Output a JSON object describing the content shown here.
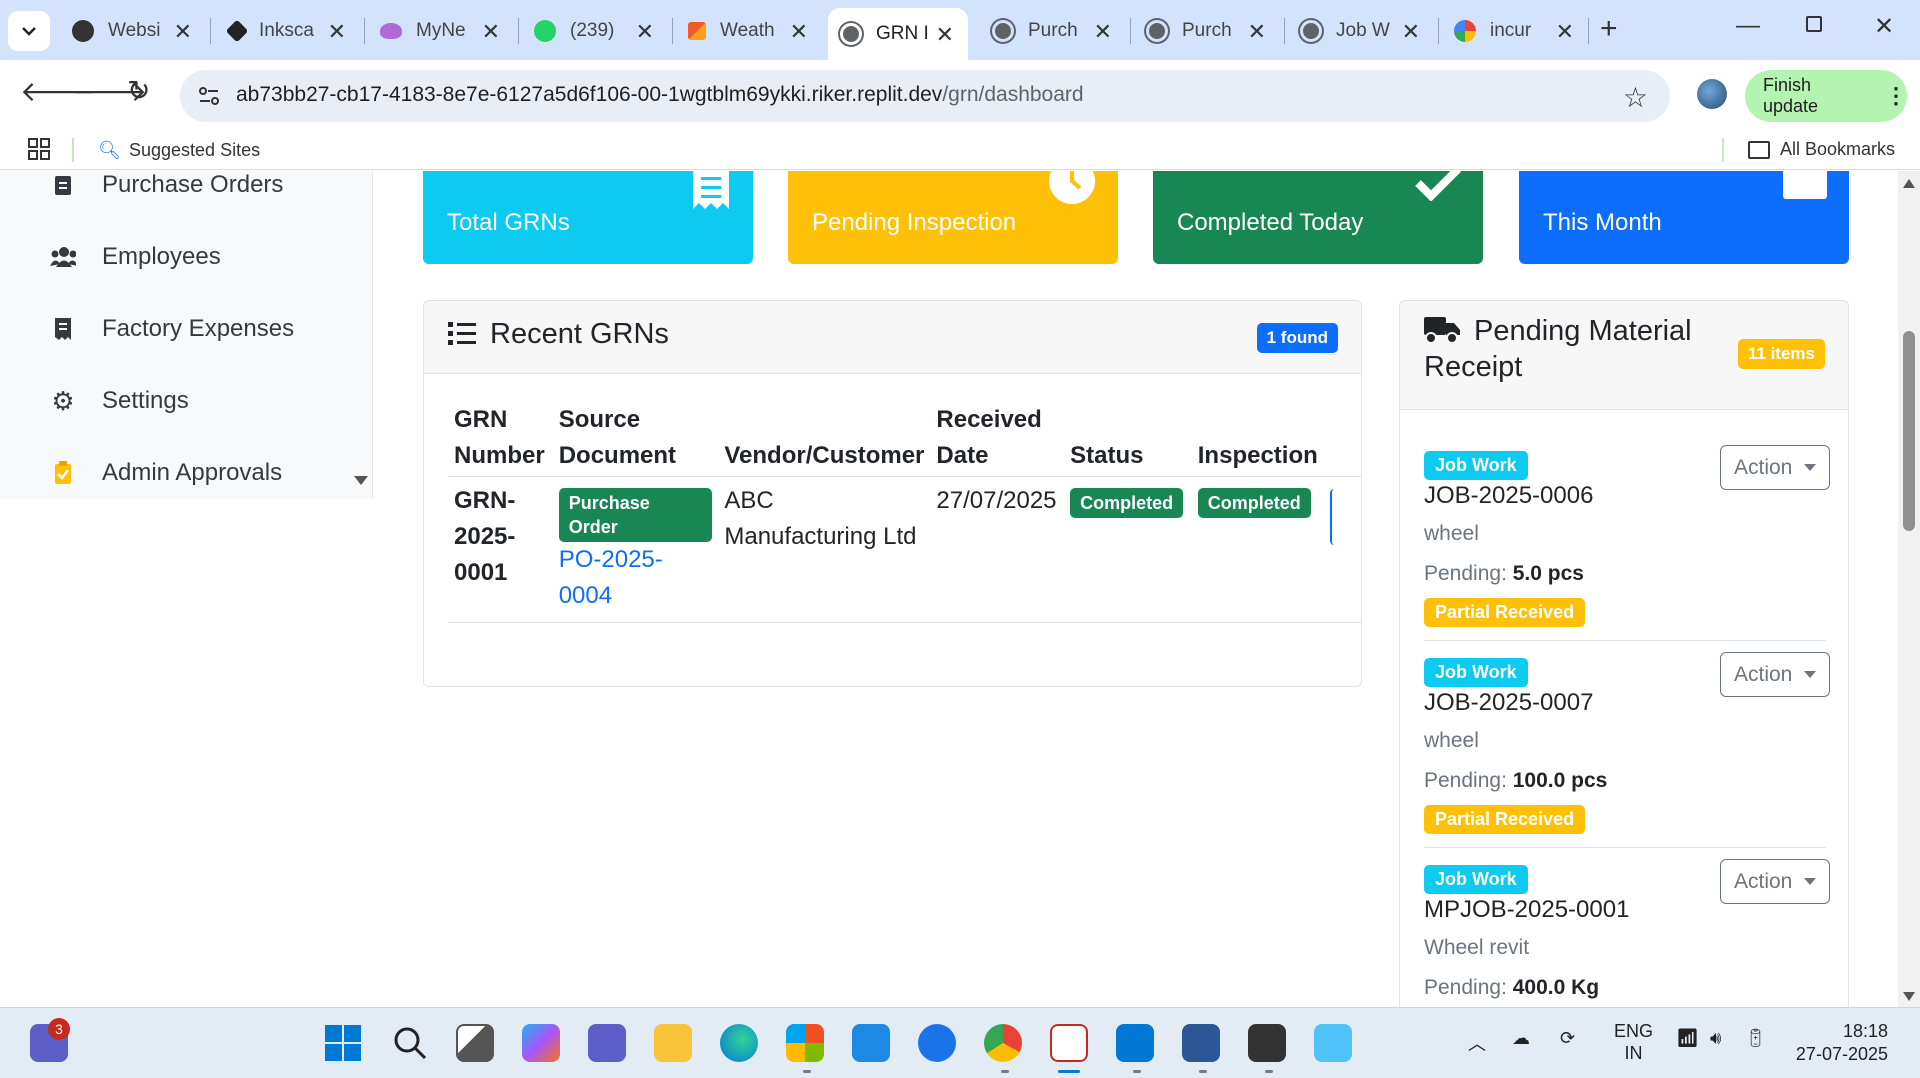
{
  "browser": {
    "tabs": [
      {
        "label": "Websi",
        "color": "#333333"
      },
      {
        "label": "Inksca",
        "color": "#222222"
      },
      {
        "label": "MyNe",
        "color": "#b06ad6"
      },
      {
        "label": "(239)",
        "color": "#25d366"
      },
      {
        "label": "Weath",
        "color": "#f05a28"
      },
      {
        "label": "GRN I",
        "color": "#5f6368"
      },
      {
        "label": "Purch",
        "color": "#5f6368"
      },
      {
        "label": "Purch",
        "color": "#5f6368"
      },
      {
        "label": "Job W",
        "color": "#5f6368"
      },
      {
        "label": "incur",
        "color": "#4285f4"
      }
    ],
    "url_host": "ab73bb27-cb17-4183-8e7e-6127a5d6f106-00-1wgtblm69ykki.riker.replit.dev",
    "url_path": "/grn/dashboard",
    "update_label": "Finish update",
    "bookmarks": {
      "suggested": "Suggested Sites",
      "all": "All Bookmarks"
    }
  },
  "sidebar": {
    "items": [
      {
        "label": "Purchase Orders",
        "icon": "clipboard-icon"
      },
      {
        "label": "Employees",
        "icon": "users-icon"
      },
      {
        "label": "Factory Expenses",
        "icon": "receipt-icon"
      },
      {
        "label": "Settings",
        "icon": "gear-icon"
      },
      {
        "label": "Admin Approvals",
        "icon": "clipboard-check-icon"
      }
    ]
  },
  "stats": [
    {
      "label": "Total GRNs",
      "color": "#0dcaf0",
      "icon": "receipt-icon"
    },
    {
      "label": "Pending Inspection",
      "color": "#ffc107",
      "icon": "clock-icon"
    },
    {
      "label": "Completed Today",
      "color": "#198754",
      "icon": "check-icon"
    },
    {
      "label": "This Month",
      "color": "#0d6efd",
      "icon": "calendar-icon"
    }
  ],
  "recent": {
    "title": "Recent GRNs",
    "badge": "1 found",
    "headers": {
      "grn_1": "GRN",
      "grn_2": "Number",
      "src_1": "Source",
      "src_2": "Document",
      "vendor": "Vendor/Customer",
      "date_1": "Received",
      "date_2": "Date",
      "status": "Status",
      "inspection": "Inspection"
    },
    "row": {
      "grn_1": "GRN-",
      "grn_2": "2025-",
      "grn_3": "0001",
      "source_type": "Purchase Order",
      "source_no": "PO-2025-0004",
      "vendor_1": "ABC",
      "vendor_2": "Manufacturing Ltd",
      "date": "27/07/2025",
      "status": "Completed",
      "inspection": "Completed"
    }
  },
  "pending": {
    "title_1": "Pending Material",
    "title_2": "Receipt",
    "badge": "11 items",
    "action_label": "Action",
    "items": [
      {
        "type": "Job Work",
        "no": "JOB-2025-0006",
        "desc": "wheel",
        "qty_label": "Pending:",
        "qty": "5.0 pcs",
        "status": "Partial Received"
      },
      {
        "type": "Job Work",
        "no": "JOB-2025-0007",
        "desc": "wheel",
        "qty_label": "Pending:",
        "qty": "100.0 pcs",
        "status": "Partial Received"
      },
      {
        "type": "Job Work",
        "no": "MPJOB-2025-0001",
        "desc": "Wheel revit",
        "qty_label": "Pending:",
        "qty": "400.0 Kg",
        "status": ""
      }
    ]
  },
  "taskbar": {
    "badge": "3",
    "lang_1": "ENG",
    "lang_2": "IN",
    "time": "18:18",
    "date": "27-07-2025"
  }
}
